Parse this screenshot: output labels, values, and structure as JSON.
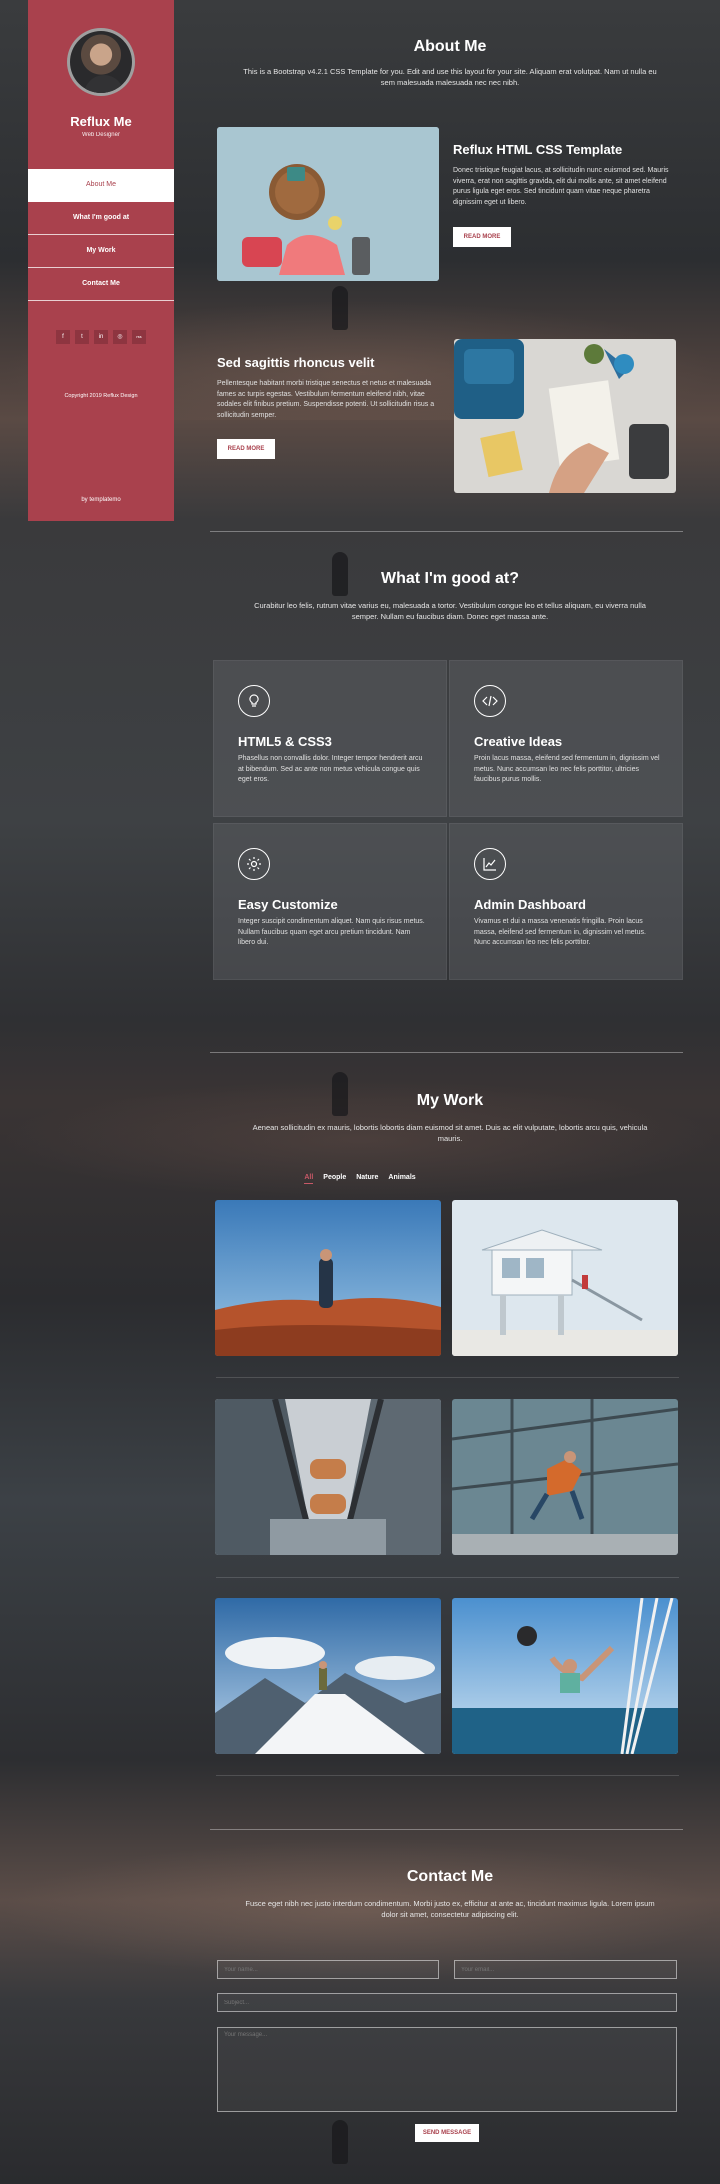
{
  "sidebar": {
    "name": "Reflux Me",
    "role": "Web Designer",
    "nav": [
      "About Me",
      "What I'm good at",
      "My Work",
      "Contact Me"
    ],
    "socials": [
      "f",
      "t",
      "in",
      "◎",
      "rss"
    ],
    "copyright": "Copyright 2019 Reflux Design",
    "credit": "by templatemo"
  },
  "about": {
    "title": "About Me",
    "intro": "This is a Bootstrap v4.2.1 CSS Template for you. Edit and use this layout for your site. Aliquam erat volutpat. Nam ut nulla eu sem malesuada malesuada nec nec nibh.",
    "blocks": [
      {
        "title": "Reflux HTML CSS Template",
        "text": "Donec tristique feugiat lacus, at sollicitudin nunc euismod sed. Mauris viverra, erat non sagittis gravida, elit dui mollis ante, sit amet eleifend purus ligula eget eros. Sed tincidunt quam vitae neque pharetra dignissim eget ut libero.",
        "button": "READ MORE"
      },
      {
        "title": "Sed sagittis rhoncus velit",
        "text": "Pellentesque habitant morbi tristique senectus et netus et malesuada fames ac turpis egestas. Vestibulum fermentum eleifend nibh, vitae sodales elit finibus pretium. Suspendisse potenti. Ut sollicitudin risus a sollicitudin semper.",
        "button": "READ MORE"
      }
    ]
  },
  "skills": {
    "title": "What I'm good at?",
    "intro": "Curabitur leo felis, rutrum vitae varius eu, malesuada a tortor. Vestibulum congue leo et tellus aliquam, eu viverra nulla semper. Nullam eu faucibus diam. Donec eget massa ante.",
    "items": [
      {
        "icon": "lightbulb-icon",
        "title": "HTML5 & CSS3",
        "text": "Phasellus non convallis dolor. Integer tempor hendrerit arcu at bibendum. Sed ac ante non metus vehicula congue quis eget eros."
      },
      {
        "icon": "code-icon",
        "title": "Creative Ideas",
        "text": "Proin lacus massa, eleifend sed fermentum in, dignissim vel metus. Nunc accumsan leo nec felis porttitor, ultricies faucibus purus mollis."
      },
      {
        "icon": "gear-icon",
        "title": "Easy Customize",
        "text": "Integer suscipit condimentum aliquet. Nam quis risus metus. Nullam faucibus quam eget arcu pretium tincidunt. Nam libero dui."
      },
      {
        "icon": "chart-icon",
        "title": "Admin Dashboard",
        "text": "Vivamus et dui a massa venenatis fringilla. Proin lacus massa, eleifend sed fermentum in, dignissim vel metus. Nunc accumsan leo nec felis porttitor."
      }
    ]
  },
  "work": {
    "title": "My Work",
    "intro": "Aenean sollicitudin ex mauris, lobortis lobortis diam euismod sit amet. Duis ac elit vulputate, lobortis arcu quis, vehicula mauris.",
    "filters": [
      "All",
      "People",
      "Nature",
      "Animals"
    ]
  },
  "contact": {
    "title": "Contact Me",
    "intro": "Fusce eget nibh nec justo interdum condimentum. Morbi justo ex, efficitur at ante ac, tincidunt maximus ligula. Lorem ipsum dolor sit amet, consectetur adipiscing elit.",
    "name_placeholder": "Your name...",
    "email_placeholder": "Your email...",
    "subject_placeholder": "Subject...",
    "message_placeholder": "Your message...",
    "send": "SEND MESSAGE"
  }
}
